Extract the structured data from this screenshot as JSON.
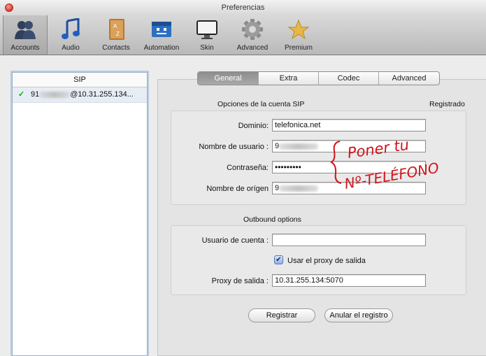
{
  "window": {
    "title": "Preferencias"
  },
  "toolbar": {
    "items": [
      {
        "label": "Accounts",
        "icon": "accounts-icon"
      },
      {
        "label": "Audio",
        "icon": "audio-icon"
      },
      {
        "label": "Contacts",
        "icon": "contacts-icon"
      },
      {
        "label": "Automation",
        "icon": "automation-icon"
      },
      {
        "label": "Skin",
        "icon": "skin-icon"
      },
      {
        "label": "Advanced",
        "icon": "gear-icon"
      },
      {
        "label": "Premium",
        "icon": "star-icon"
      }
    ],
    "active": "Accounts"
  },
  "sidebar": {
    "header": "SIP",
    "accounts": [
      {
        "prefix": "91",
        "suffix": "@10.31.255.134...",
        "status": "registered"
      }
    ]
  },
  "tabs": [
    "General",
    "Extra",
    "Codec",
    "Advanced"
  ],
  "active_tab": "General",
  "sip_options": {
    "title": "Opciones de la cuenta SIP",
    "status": "Registrado",
    "domain_label": "Dominio:",
    "domain_value": "telefonica.net",
    "username_label": "Nombre de usuario :",
    "username_value": "9",
    "password_label": "Contraseña:",
    "password_value": "•••••••••",
    "origin_label": "Nombre de orígen",
    "origin_value": "9"
  },
  "outbound": {
    "title": "Outbound options",
    "account_user_label": "Usuario de cuenta :",
    "account_user_value": "",
    "use_proxy_label": "Usar el proxy de salida",
    "use_proxy_checked": true,
    "proxy_label": "Proxy de salida :",
    "proxy_value": "10.31.255.134:5070"
  },
  "buttons": {
    "register": "Registrar",
    "unregister": "Anular el registro"
  },
  "annotation": {
    "line1": "Poner tu",
    "line2": "Nº-TELÉFONO"
  },
  "colors": {
    "annotation": "#d0141a",
    "accent": "#4a74b3",
    "check": "#1aa31a"
  }
}
